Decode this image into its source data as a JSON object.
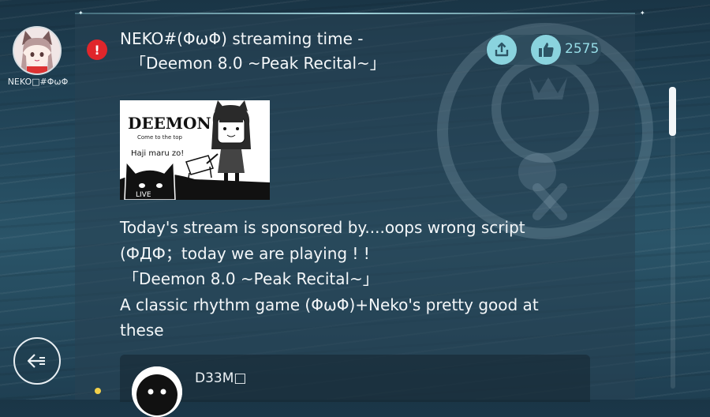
{
  "author": {
    "name": "NEKO□#ΦωΦ"
  },
  "post": {
    "title_line1": "NEKO#(ΦωΦ) streaming time -",
    "title_line2": "「Deemon 8.0 ~Peak Recital~」",
    "body_lines": [
      "Today's stream is sponsored by....oops wrong script",
      "(ФДФ；today we are playing ! !",
      "「Deemon 8.0 ~Peak Recital~」",
      "A classic rhythm game (ΦωΦ)+Neko's pretty good at",
      "these"
    ],
    "like_count": "2575",
    "thumbnail": {
      "logo": "DEEMON",
      "tagline": "Come to the top",
      "caption": "Haji maru zo!",
      "badge": "LIVE"
    }
  },
  "reply": {
    "name": "D33M□"
  },
  "icons": {
    "alert": "alert-icon",
    "share": "share-icon",
    "like": "thumbs-up-icon",
    "back": "back-arrow-icon"
  },
  "colors": {
    "accent": "#8ad3de",
    "like_count": "#96dce6",
    "alert": "#e0262b",
    "indicator": "#f2d04a"
  }
}
